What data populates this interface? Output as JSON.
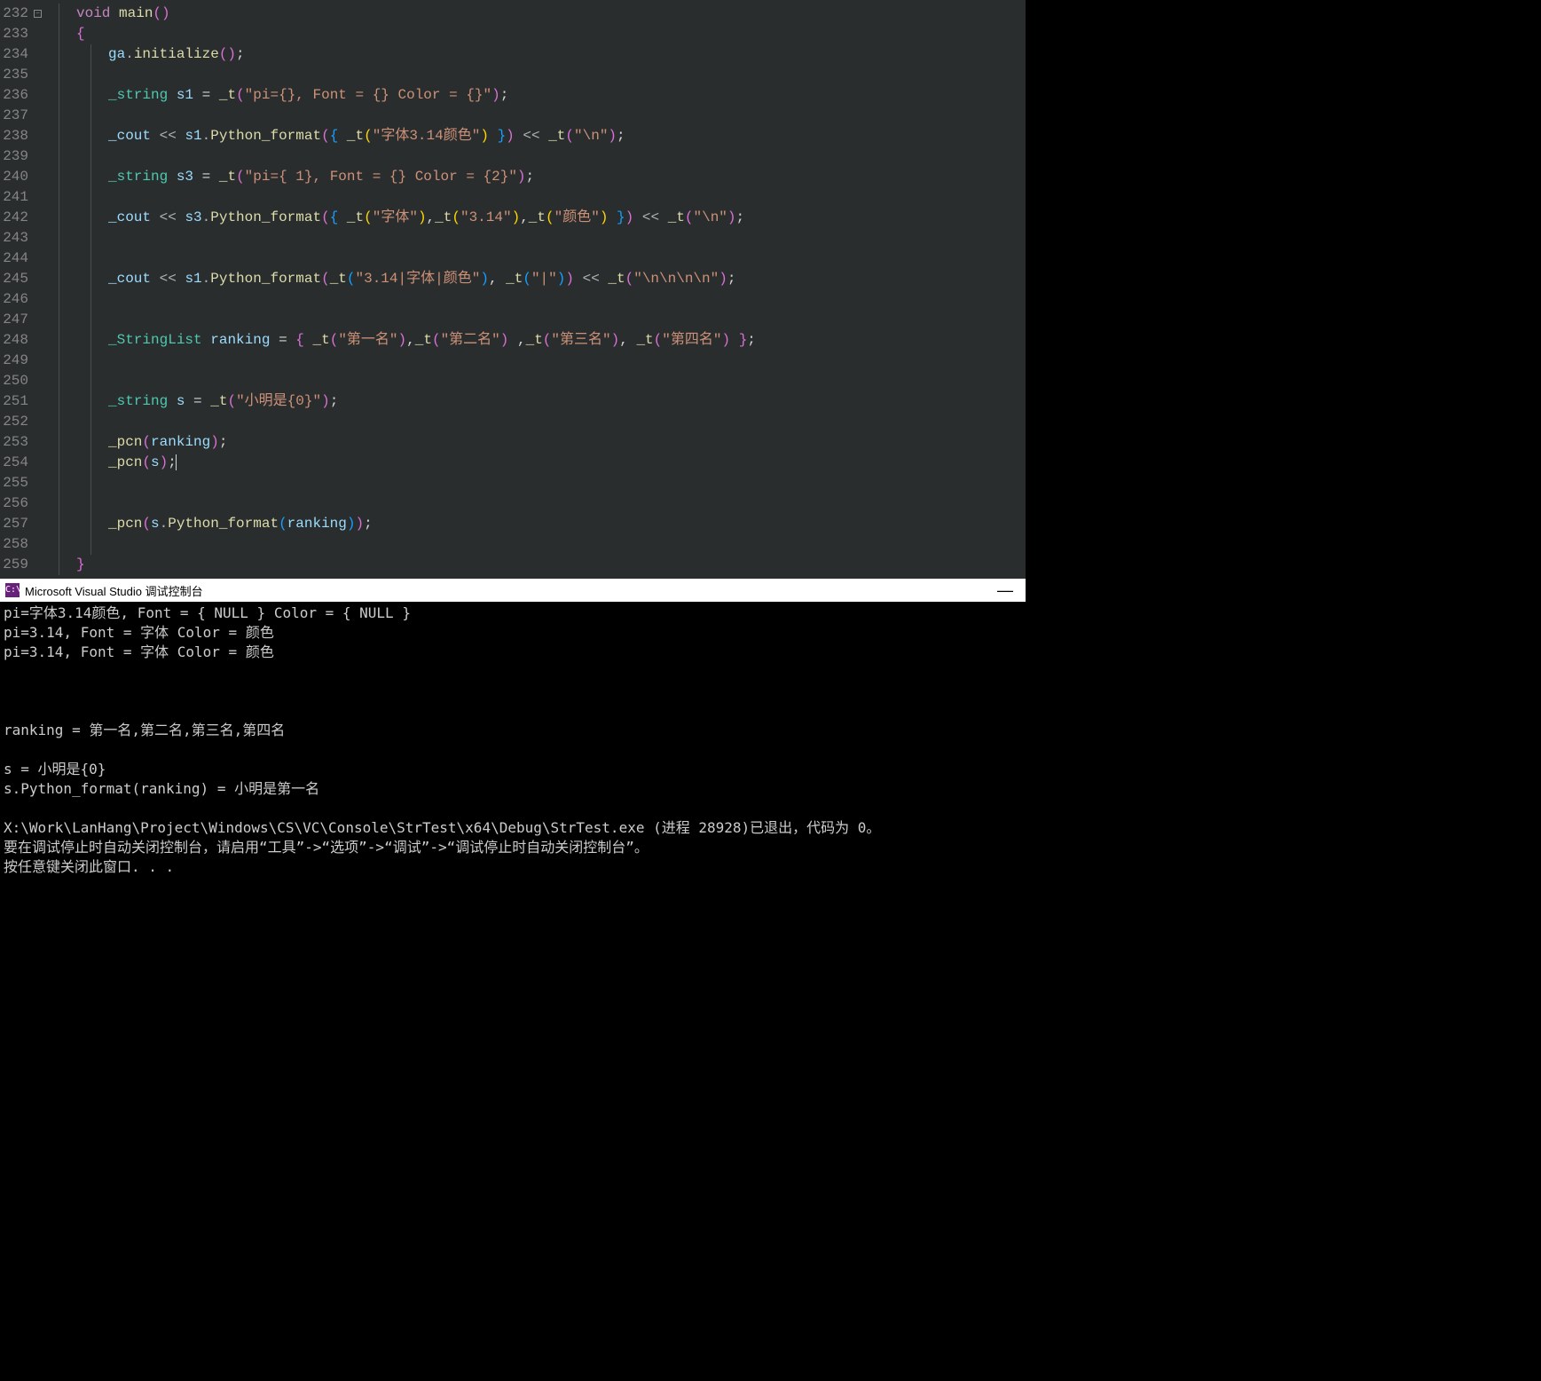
{
  "editor": {
    "startLine": 232,
    "lines": [
      {
        "indent": 1,
        "outline": true,
        "tokens": [
          [
            "k-void",
            "void"
          ],
          [
            "",
            " "
          ],
          [
            "k-func",
            "main"
          ],
          [
            "k-paren",
            "()"
          ]
        ]
      },
      {
        "indent": 1,
        "tokens": [
          [
            "k-brace",
            "{"
          ]
        ]
      },
      {
        "indent": 2,
        "tokens": [
          [
            "k-obj",
            "ga"
          ],
          [
            "k-op",
            "."
          ],
          [
            "k-func",
            "initialize"
          ],
          [
            "k-paren",
            "()"
          ],
          [
            "",
            ";"
          ]
        ]
      },
      {
        "indent": 2,
        "tokens": []
      },
      {
        "indent": 2,
        "tokens": [
          [
            "k-class",
            "_string"
          ],
          [
            "",
            " "
          ],
          [
            "k-ident",
            "s1"
          ],
          [
            "",
            " "
          ],
          [
            "k-eq",
            "="
          ],
          [
            "",
            " "
          ],
          [
            "k-func",
            "_t"
          ],
          [
            "k-paren",
            "("
          ],
          [
            "k-str",
            "\"pi={}, Font = {} Color = {}\""
          ],
          [
            "k-paren",
            ")"
          ],
          [
            "",
            ";"
          ]
        ]
      },
      {
        "indent": 2,
        "tokens": []
      },
      {
        "indent": 2,
        "tokens": [
          [
            "k-obj",
            "_cout"
          ],
          [
            "",
            " "
          ],
          [
            "k-op",
            "<<"
          ],
          [
            "",
            " "
          ],
          [
            "k-ident",
            "s1"
          ],
          [
            "k-op",
            "."
          ],
          [
            "k-func",
            "Python_format"
          ],
          [
            "k-paren",
            "("
          ],
          [
            "k-paren2",
            "{"
          ],
          [
            "",
            " "
          ],
          [
            "k-func",
            "_t"
          ],
          [
            "k-paren3",
            "("
          ],
          [
            "k-str",
            "\"字体3.14颜色\""
          ],
          [
            "k-paren3",
            ")"
          ],
          [
            "",
            " "
          ],
          [
            "k-paren2",
            "}"
          ],
          [
            "k-paren",
            ")"
          ],
          [
            "",
            " "
          ],
          [
            "k-op",
            "<<"
          ],
          [
            "",
            " "
          ],
          [
            "k-func",
            "_t"
          ],
          [
            "k-paren",
            "("
          ],
          [
            "k-str",
            "\"\\n\""
          ],
          [
            "k-paren",
            ")"
          ],
          [
            "",
            ";"
          ]
        ]
      },
      {
        "indent": 2,
        "tokens": []
      },
      {
        "indent": 2,
        "tokens": [
          [
            "k-class",
            "_string"
          ],
          [
            "",
            " "
          ],
          [
            "k-ident",
            "s3"
          ],
          [
            "",
            " "
          ],
          [
            "k-eq",
            "="
          ],
          [
            "",
            " "
          ],
          [
            "k-func",
            "_t"
          ],
          [
            "k-paren",
            "("
          ],
          [
            "k-str",
            "\"pi={ 1}, Font = {} Color = {2}\""
          ],
          [
            "k-paren",
            ")"
          ],
          [
            "",
            ";"
          ]
        ]
      },
      {
        "indent": 2,
        "tokens": []
      },
      {
        "indent": 2,
        "tokens": [
          [
            "k-obj",
            "_cout"
          ],
          [
            "",
            " "
          ],
          [
            "k-op",
            "<<"
          ],
          [
            "",
            " "
          ],
          [
            "k-ident",
            "s3"
          ],
          [
            "k-op",
            "."
          ],
          [
            "k-func",
            "Python_format"
          ],
          [
            "k-paren",
            "("
          ],
          [
            "k-paren2",
            "{"
          ],
          [
            "",
            " "
          ],
          [
            "k-func",
            "_t"
          ],
          [
            "k-paren3",
            "("
          ],
          [
            "k-str",
            "\"字体\""
          ],
          [
            "k-paren3",
            ")"
          ],
          [
            "",
            ","
          ],
          [
            "k-func",
            "_t"
          ],
          [
            "k-paren3",
            "("
          ],
          [
            "k-str",
            "\"3.14\""
          ],
          [
            "k-paren3",
            ")"
          ],
          [
            "",
            ","
          ],
          [
            "k-func",
            "_t"
          ],
          [
            "k-paren3",
            "("
          ],
          [
            "k-str",
            "\"颜色\""
          ],
          [
            "k-paren3",
            ")"
          ],
          [
            "",
            " "
          ],
          [
            "k-paren2",
            "}"
          ],
          [
            "k-paren",
            ")"
          ],
          [
            "",
            " "
          ],
          [
            "k-op",
            "<<"
          ],
          [
            "",
            " "
          ],
          [
            "k-func",
            "_t"
          ],
          [
            "k-paren",
            "("
          ],
          [
            "k-str",
            "\"\\n\""
          ],
          [
            "k-paren",
            ")"
          ],
          [
            "",
            ";"
          ]
        ]
      },
      {
        "indent": 2,
        "tokens": []
      },
      {
        "indent": 2,
        "tokens": []
      },
      {
        "indent": 2,
        "tokens": [
          [
            "k-obj",
            "_cout"
          ],
          [
            "",
            " "
          ],
          [
            "k-op",
            "<<"
          ],
          [
            "",
            " "
          ],
          [
            "k-ident",
            "s1"
          ],
          [
            "k-op",
            "."
          ],
          [
            "k-func",
            "Python_format"
          ],
          [
            "k-paren",
            "("
          ],
          [
            "k-func",
            "_t"
          ],
          [
            "k-paren2",
            "("
          ],
          [
            "k-str",
            "\"3.14|字体|颜色\""
          ],
          [
            "k-paren2",
            ")"
          ],
          [
            "",
            ", "
          ],
          [
            "k-func",
            "_t"
          ],
          [
            "k-paren2",
            "("
          ],
          [
            "k-str",
            "\"|\""
          ],
          [
            "k-paren2",
            ")"
          ],
          [
            "k-paren",
            ")"
          ],
          [
            "",
            " "
          ],
          [
            "k-op",
            "<<"
          ],
          [
            "",
            " "
          ],
          [
            "k-func",
            "_t"
          ],
          [
            "k-paren",
            "("
          ],
          [
            "k-str",
            "\"\\n\\n\\n\\n\""
          ],
          [
            "k-paren",
            ")"
          ],
          [
            "",
            ";"
          ]
        ]
      },
      {
        "indent": 2,
        "tokens": []
      },
      {
        "indent": 2,
        "tokens": []
      },
      {
        "indent": 2,
        "tokens": [
          [
            "k-class",
            "_StringList"
          ],
          [
            "",
            " "
          ],
          [
            "k-ident",
            "ranking"
          ],
          [
            "",
            " "
          ],
          [
            "k-eq",
            "="
          ],
          [
            "",
            " "
          ],
          [
            "k-brace",
            "{"
          ],
          [
            "",
            " "
          ],
          [
            "k-func",
            "_t"
          ],
          [
            "k-paren",
            "("
          ],
          [
            "k-str",
            "\"第一名\""
          ],
          [
            "k-paren",
            ")"
          ],
          [
            "",
            ","
          ],
          [
            "k-func",
            "_t"
          ],
          [
            "k-paren",
            "("
          ],
          [
            "k-str",
            "\"第二名\""
          ],
          [
            "k-paren",
            ")"
          ],
          [
            "",
            " ,"
          ],
          [
            "k-func",
            "_t"
          ],
          [
            "k-paren",
            "("
          ],
          [
            "k-str",
            "\"第三名\""
          ],
          [
            "k-paren",
            ")"
          ],
          [
            "",
            ", "
          ],
          [
            "k-func",
            "_t"
          ],
          [
            "k-paren",
            "("
          ],
          [
            "k-str",
            "\"第四名\""
          ],
          [
            "k-paren",
            ")"
          ],
          [
            "",
            " "
          ],
          [
            "k-brace",
            "}"
          ],
          [
            "",
            ";"
          ]
        ]
      },
      {
        "indent": 2,
        "tokens": []
      },
      {
        "indent": 2,
        "tokens": []
      },
      {
        "indent": 2,
        "tokens": [
          [
            "k-class",
            "_string"
          ],
          [
            "",
            " "
          ],
          [
            "k-ident",
            "s"
          ],
          [
            "",
            " "
          ],
          [
            "k-eq",
            "="
          ],
          [
            "",
            " "
          ],
          [
            "k-func",
            "_t"
          ],
          [
            "k-paren",
            "("
          ],
          [
            "k-str",
            "\"小明是{0}\""
          ],
          [
            "k-paren",
            ")"
          ],
          [
            "",
            ";"
          ]
        ]
      },
      {
        "indent": 2,
        "tokens": []
      },
      {
        "indent": 2,
        "tokens": [
          [
            "k-func",
            "_pcn"
          ],
          [
            "k-paren",
            "("
          ],
          [
            "k-ident",
            "ranking"
          ],
          [
            "k-paren",
            ")"
          ],
          [
            "",
            ";"
          ]
        ]
      },
      {
        "indent": 2,
        "cursor": true,
        "tokens": [
          [
            "k-func",
            "_pcn"
          ],
          [
            "k-paren",
            "("
          ],
          [
            "k-ident",
            "s"
          ],
          [
            "k-paren",
            ")"
          ],
          [
            "",
            ";"
          ]
        ]
      },
      {
        "indent": 2,
        "tokens": []
      },
      {
        "indent": 2,
        "tokens": []
      },
      {
        "indent": 2,
        "tokens": [
          [
            "k-func",
            "_pcn"
          ],
          [
            "k-paren",
            "("
          ],
          [
            "k-ident",
            "s"
          ],
          [
            "k-op",
            "."
          ],
          [
            "k-func",
            "Python_format"
          ],
          [
            "k-paren2",
            "("
          ],
          [
            "k-ident",
            "ranking"
          ],
          [
            "k-paren2",
            ")"
          ],
          [
            "k-paren",
            ")"
          ],
          [
            "",
            ";"
          ]
        ]
      },
      {
        "indent": 2,
        "tokens": []
      },
      {
        "indent": 1,
        "tokens": [
          [
            "k-brace",
            "}"
          ]
        ]
      }
    ]
  },
  "console": {
    "iconText": "C:\\",
    "title": "Microsoft Visual Studio 调试控制台",
    "minimize": "—",
    "lines": [
      "pi=字体3.14颜色, Font = { NULL } Color = { NULL }",
      "pi=3.14, Font = 字体 Color = 颜色",
      "pi=3.14, Font = 字体 Color = 颜色",
      "",
      "",
      "",
      "ranking = 第一名,第二名,第三名,第四名",
      "",
      "s = 小明是{0}",
      "s.Python_format(ranking) = 小明是第一名",
      "",
      "X:\\Work\\LanHang\\Project\\Windows\\CS\\VC\\Console\\StrTest\\x64\\Debug\\StrTest.exe (进程 28928)已退出，代码为 0。",
      "要在调试停止时自动关闭控制台，请启用“工具”->“选项”->“调试”->“调试停止时自动关闭控制台”。",
      "按任意键关闭此窗口. . ."
    ]
  }
}
